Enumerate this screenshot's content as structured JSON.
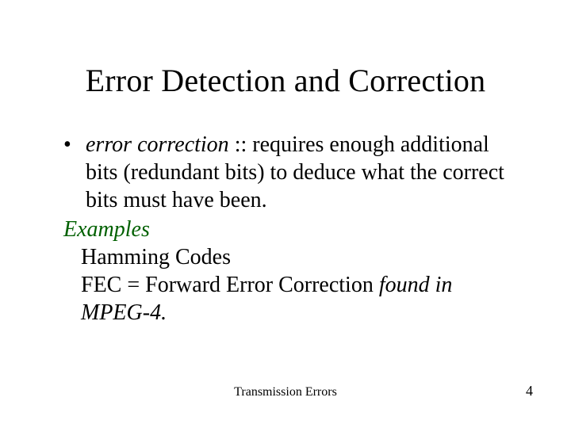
{
  "slide": {
    "title": "Error Detection and Correction",
    "bullet_term": "error correction",
    "bullet_sep": " :: ",
    "bullet_rest": "requires enough additional bits (redundant bits) to deduce what the correct bits must have been.",
    "examples_label": "Examples",
    "example_1": "Hamming Codes",
    "example_2_prefix": "FEC = Forward Error Correction ",
    "example_2_italic": "found in MPEG-4.",
    "footer_title": "Transmission Errors",
    "page_number": "4",
    "bullet_glyph": "•"
  }
}
